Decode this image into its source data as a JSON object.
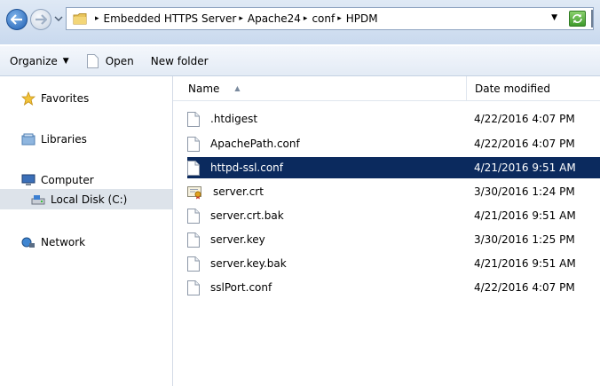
{
  "address": {
    "breadcrumbs": [
      "Embedded HTTPS Server",
      "Apache24",
      "conf",
      "HPDM"
    ]
  },
  "toolbar": {
    "organize": "Organize",
    "open": "Open",
    "new_folder": "New folder"
  },
  "nav": {
    "favorites": "Favorites",
    "libraries": "Libraries",
    "computer": "Computer",
    "local_disk": "Local Disk (C:)",
    "network": "Network"
  },
  "columns": {
    "name": "Name",
    "date": "Date modified"
  },
  "files": [
    {
      "name": ".htdigest",
      "date": "4/22/2016 4:07 PM",
      "icon": "file-icon"
    },
    {
      "name": "ApachePath.conf",
      "date": "4/22/2016 4:07 PM",
      "icon": "file-icon"
    },
    {
      "name": "httpd-ssl.conf",
      "date": "4/21/2016 9:51 AM",
      "icon": "file-icon",
      "selected": true
    },
    {
      "name": "server.crt",
      "date": "3/30/2016 1:24 PM",
      "icon": "certificate-icon"
    },
    {
      "name": "server.crt.bak",
      "date": "4/21/2016 9:51 AM",
      "icon": "file-icon"
    },
    {
      "name": "server.key",
      "date": "3/30/2016 1:25 PM",
      "icon": "file-icon"
    },
    {
      "name": "server.key.bak",
      "date": "4/21/2016 9:51 AM",
      "icon": "file-icon"
    },
    {
      "name": "sslPort.conf",
      "date": "4/22/2016 4:07 PM",
      "icon": "file-icon"
    }
  ],
  "colors": {
    "selection": "#0b2a5e",
    "nav_selection": "#dde3ea"
  }
}
